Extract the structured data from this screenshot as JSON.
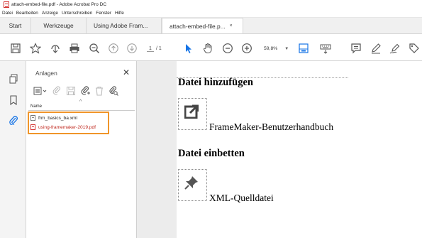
{
  "window": {
    "title": "attach-embed-file.pdf - Adobe Acrobat Pro DC"
  },
  "menu": [
    "Datei",
    "Bearbeiten",
    "Anzeige",
    "Unterschreiben",
    "Fenster",
    "Hilfe"
  ],
  "tabs": [
    {
      "label": "Start"
    },
    {
      "label": "Werkzeuge"
    },
    {
      "label": "Using Adobe Fram..."
    },
    {
      "label": "attach-embed-file.p...",
      "close": "×"
    }
  ],
  "toolbar": {
    "page_current": "1",
    "page_total": "/ 1",
    "zoom": "59,8%",
    "zoom_caret": "▼",
    "icons": [
      "save-icon",
      "star-icon",
      "upload-icon",
      "print-icon",
      "zoom-out-search-icon",
      "page-up-icon",
      "page-down-icon",
      "select-cursor-icon",
      "hand-icon",
      "zoom-minus-icon",
      "zoom-plus-icon",
      "fit-page-icon",
      "keyboard-icon",
      "comment-icon",
      "pen-icon",
      "sign-icon",
      "tag-icon"
    ]
  },
  "panel": {
    "title": "Anlagen",
    "close": "✕",
    "column_header": "Name",
    "files": [
      {
        "name": "frm_basics_ba.xml",
        "type": "xml"
      },
      {
        "name": "using-framemaker-2019.pdf",
        "type": "pdf"
      }
    ]
  },
  "document": {
    "heading1": "Datei hinzufügen",
    "link_text": "FrameMaker-Benutzerhandbuch",
    "heading2": "Datei einbetten",
    "embed_text": "XML-Quelldatei"
  },
  "colors": {
    "accent_blue": "#1473e6",
    "highlight_orange": "#f0952a",
    "pdf_red": "#d3302f"
  }
}
